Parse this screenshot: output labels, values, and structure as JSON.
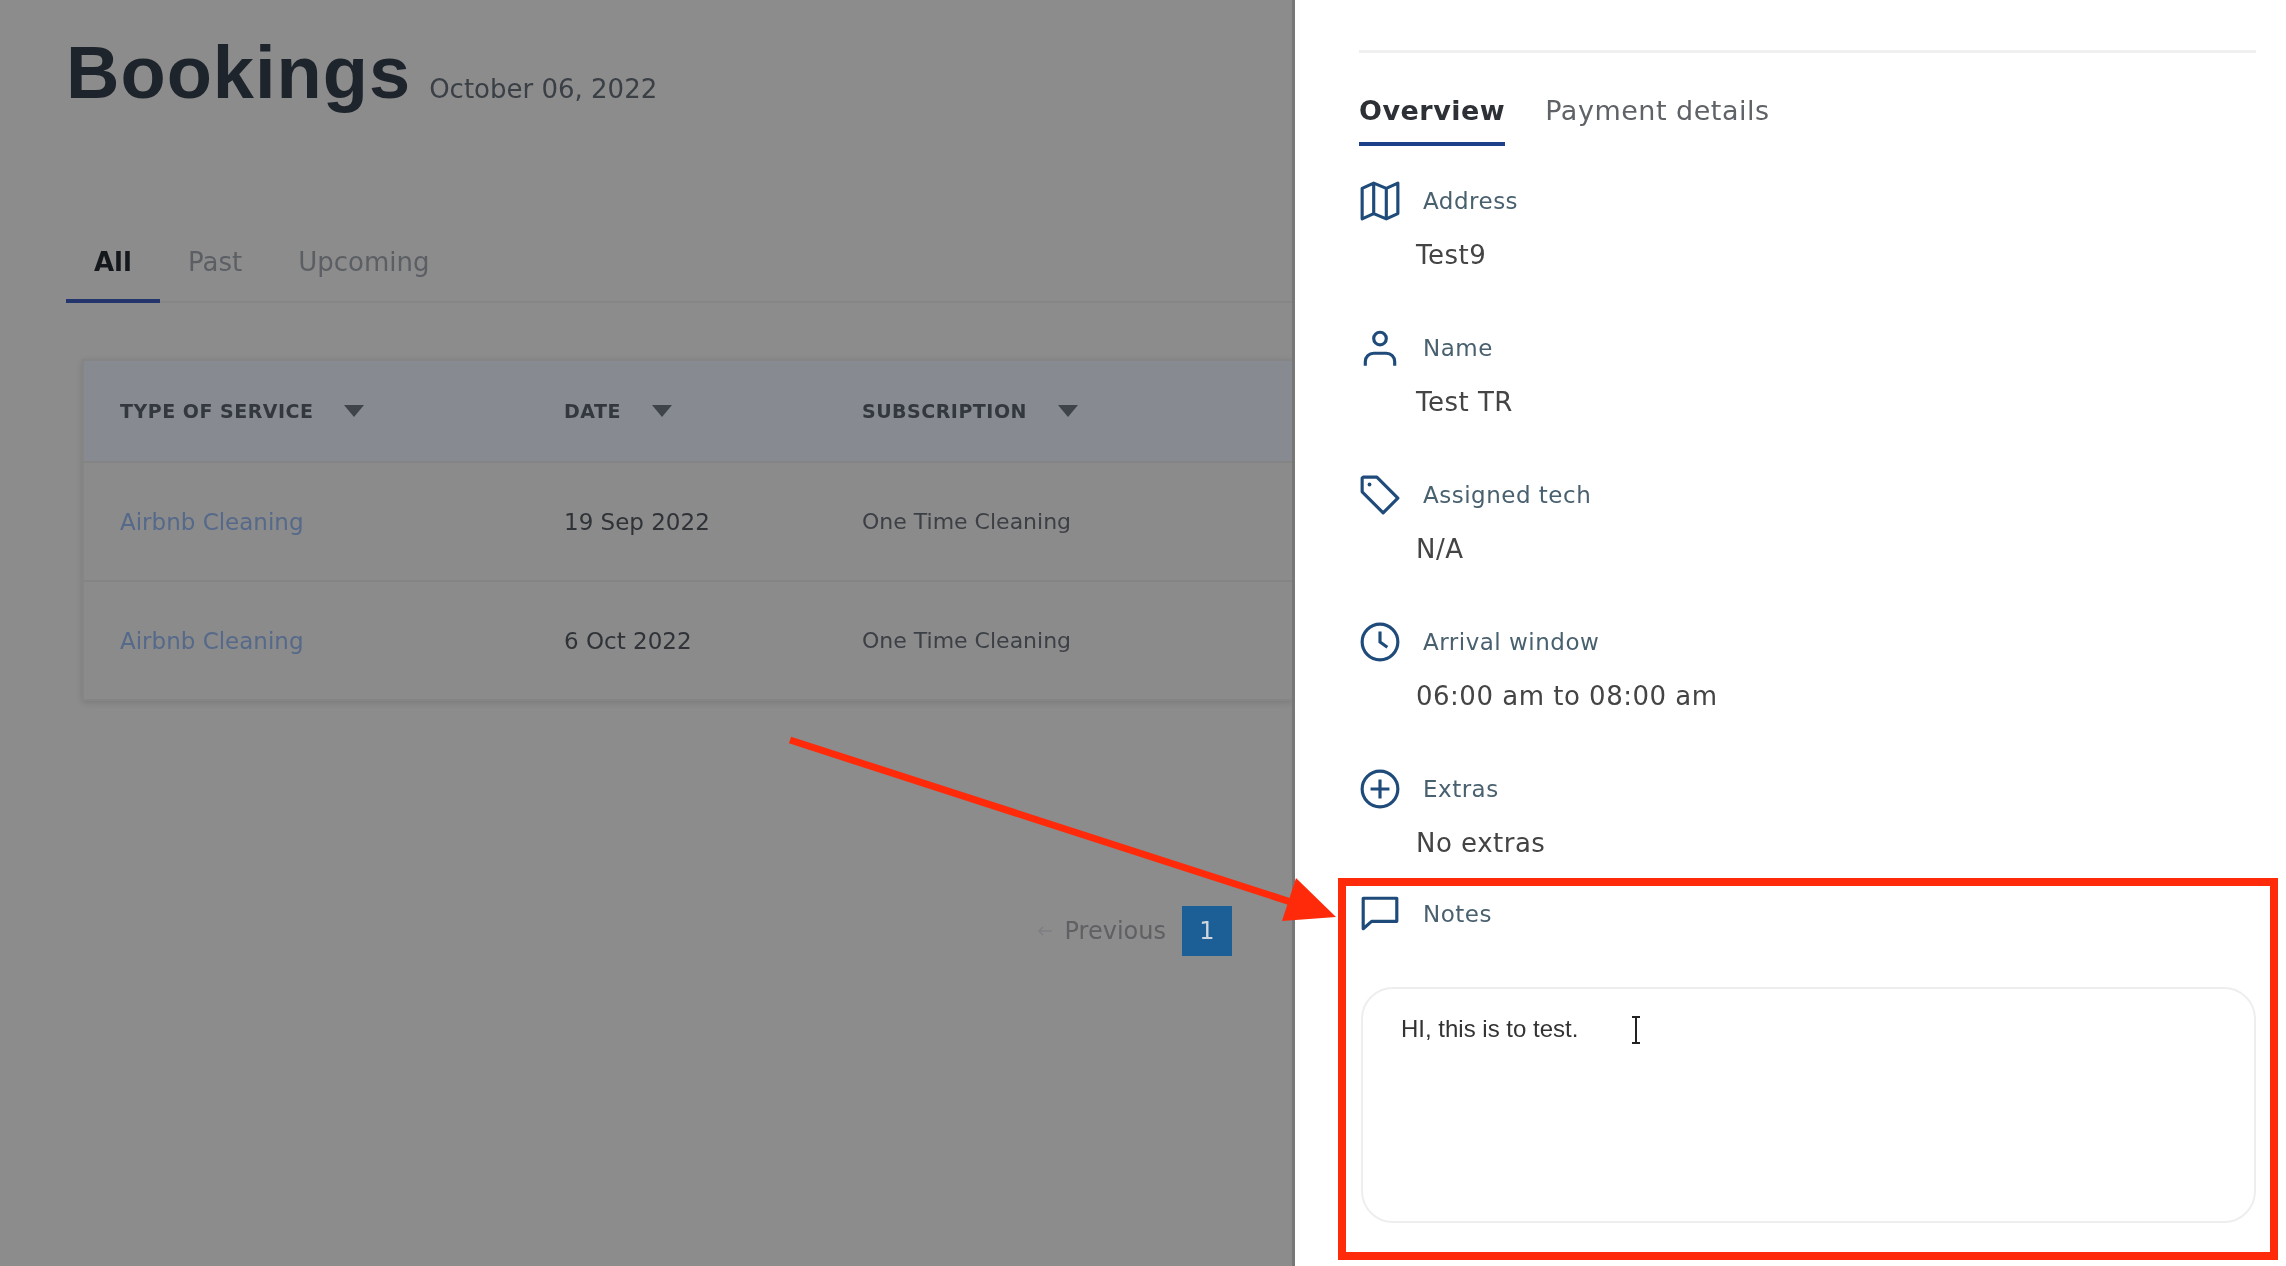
{
  "page": {
    "title": "Bookings",
    "date": "October 06, 2022"
  },
  "tabs": [
    {
      "label": "All",
      "selected": true
    },
    {
      "label": "Past",
      "selected": false
    },
    {
      "label": "Upcoming",
      "selected": false
    }
  ],
  "table": {
    "columns": [
      "TYPE OF SERVICE",
      "DATE",
      "SUBSCRIPTION"
    ],
    "rows": [
      [
        "Airbnb Cleaning",
        "19 Sep 2022",
        "One Time Cleaning"
      ],
      [
        "Airbnb Cleaning",
        "6 Oct 2022",
        "One Time Cleaning"
      ]
    ]
  },
  "pagination": {
    "previous": "Previous",
    "pages": [
      {
        "label": "1",
        "selected": true
      }
    ]
  },
  "drawer": {
    "tabs": [
      {
        "label": "Overview",
        "selected": true
      },
      {
        "label": "Payment details",
        "selected": false
      }
    ],
    "fields": [
      {
        "kind": "map",
        "label": "Address",
        "value": "Test9"
      },
      {
        "kind": "person",
        "label": "Name",
        "value": "Test TR"
      },
      {
        "kind": "tag",
        "label": "Assigned tech",
        "value": "N/A"
      },
      {
        "kind": "clock",
        "label": "Arrival window",
        "value": "06:00 am to 08:00 am"
      },
      {
        "kind": "plus",
        "label": "Extras",
        "value": "No extras"
      }
    ],
    "notes": {
      "label": "Notes",
      "value": "HI, this is to test."
    }
  }
}
